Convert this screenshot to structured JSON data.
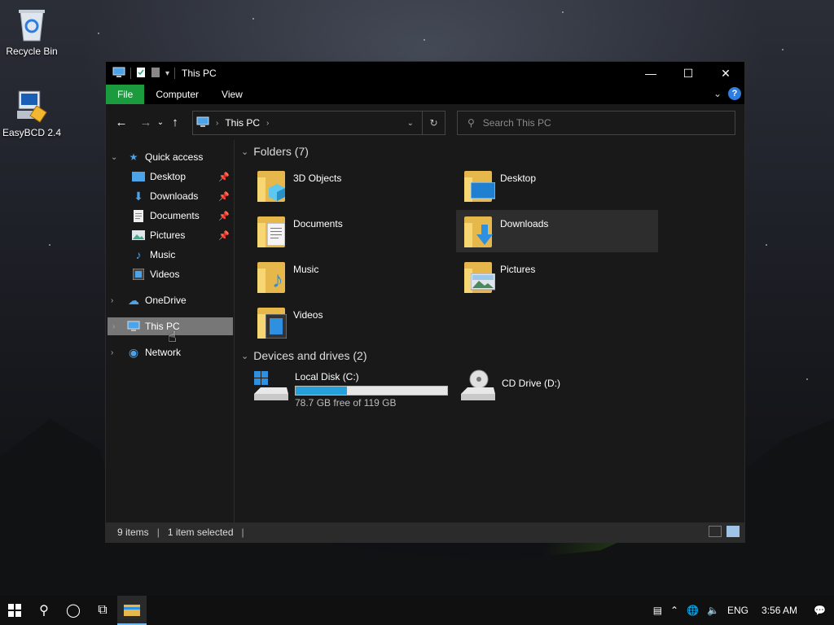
{
  "desktop": {
    "icons": [
      {
        "label": "Recycle Bin",
        "icon": "recycle-bin-icon"
      },
      {
        "label": "EasyBCD 2.4",
        "icon": "easybcd-icon"
      }
    ]
  },
  "window": {
    "title": "This PC",
    "ribbon_tabs": [
      "File",
      "Computer",
      "View"
    ],
    "address": {
      "location": "This PC"
    },
    "search": {
      "placeholder": "Search This PC"
    },
    "controls": {
      "minimize": "—",
      "maximize": "☐",
      "close": "✕"
    }
  },
  "sidebar": {
    "quick_access": {
      "label": "Quick access",
      "items": [
        {
          "label": "Desktop",
          "pinned": true
        },
        {
          "label": "Downloads",
          "pinned": true
        },
        {
          "label": "Documents",
          "pinned": true
        },
        {
          "label": "Pictures",
          "pinned": true
        },
        {
          "label": "Music",
          "pinned": false
        },
        {
          "label": "Videos",
          "pinned": false
        }
      ]
    },
    "roots": [
      {
        "label": "OneDrive"
      },
      {
        "label": "This PC",
        "selected": true
      },
      {
        "label": "Network"
      }
    ]
  },
  "main": {
    "folders_header": "Folders (7)",
    "folders": [
      {
        "label": "3D Objects"
      },
      {
        "label": "Desktop"
      },
      {
        "label": "Documents"
      },
      {
        "label": "Downloads",
        "selected": true
      },
      {
        "label": "Music"
      },
      {
        "label": "Pictures"
      },
      {
        "label": "Videos"
      }
    ],
    "devices_header": "Devices and drives (2)",
    "drives": [
      {
        "label": "Local Disk (C:)",
        "free_text": "78.7 GB free of 119 GB",
        "used_fraction": 0.34
      },
      {
        "label": "CD Drive (D:)"
      }
    ]
  },
  "statusbar": {
    "items": "9 items",
    "selected": "1 item selected"
  },
  "taskbar": {
    "language": "ENG",
    "time": "3:56 AM"
  },
  "colors": {
    "file_tab": "#1c9a3e",
    "drive_fill": "#26a0da",
    "folder": "#e6b84c"
  }
}
